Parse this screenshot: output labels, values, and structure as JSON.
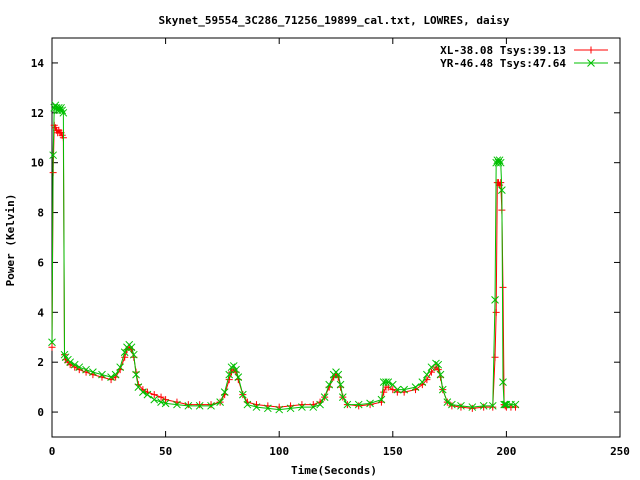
{
  "chart_data": {
    "type": "line",
    "title": "Skynet_59554_3C286_71256_19899_cal.txt, LOWRES, daisy",
    "xlabel": "Time(Seconds)",
    "ylabel": "Power (Kelvin)",
    "xlim": [
      0,
      250
    ],
    "ylim": [
      -1,
      15
    ],
    "xticks": [
      0,
      50,
      100,
      150,
      200,
      250
    ],
    "yticks": [
      0,
      2,
      4,
      6,
      8,
      10,
      12,
      14
    ],
    "grid": false,
    "legend_position": "top-right",
    "series": [
      {
        "name": "XL-38.08 Tsys:39.13",
        "color": "#ff0000",
        "marker": "plus",
        "x": [
          0,
          0.5,
          1,
          1.5,
          2,
          2.5,
          3,
          3.5,
          4,
          4.5,
          5,
          5.5,
          6,
          7,
          8,
          10,
          12,
          15,
          18,
          22,
          26,
          28,
          30,
          32,
          33,
          34,
          35,
          36,
          37,
          38,
          40,
          42,
          45,
          48,
          50,
          55,
          60,
          65,
          70,
          74,
          76,
          78,
          79,
          80,
          81,
          82,
          84,
          86,
          90,
          95,
          100,
          105,
          110,
          115,
          118,
          120,
          122,
          124,
          125,
          126,
          127,
          128,
          130,
          135,
          140,
          145,
          146,
          147,
          148,
          150,
          152,
          155,
          160,
          163,
          165,
          167,
          169,
          170,
          171,
          172,
          174,
          176,
          180,
          185,
          190,
          194,
          195,
          195.5,
          196,
          196.5,
          197,
          197.5,
          198,
          198.5,
          199,
          199.5,
          200,
          202,
          204
        ],
        "y": [
          2.6,
          9.6,
          11.5,
          11.4,
          11.3,
          11.2,
          11.3,
          11.2,
          11.2,
          11.1,
          11.0,
          2.3,
          2.1,
          2.0,
          1.9,
          1.8,
          1.7,
          1.6,
          1.5,
          1.4,
          1.3,
          1.4,
          1.7,
          2.2,
          2.5,
          2.6,
          2.5,
          2.2,
          1.6,
          1.1,
          0.9,
          0.8,
          0.7,
          0.6,
          0.5,
          0.4,
          0.3,
          0.3,
          0.3,
          0.4,
          0.7,
          1.3,
          1.6,
          1.7,
          1.6,
          1.3,
          0.7,
          0.4,
          0.3,
          0.25,
          0.2,
          0.25,
          0.3,
          0.3,
          0.4,
          0.6,
          1.0,
          1.4,
          1.5,
          1.4,
          1.0,
          0.6,
          0.3,
          0.25,
          0.3,
          0.4,
          0.8,
          1.0,
          1.0,
          0.9,
          0.8,
          0.8,
          0.9,
          1.1,
          1.3,
          1.6,
          1.8,
          1.7,
          1.4,
          0.9,
          0.4,
          0.25,
          0.2,
          0.15,
          0.2,
          0.2,
          2.2,
          4.0,
          9.2,
          9.2,
          9.1,
          9.2,
          8.1,
          5.0,
          0.3,
          0.25,
          0.2,
          0.2,
          0.2
        ]
      },
      {
        "name": "YR-46.48 Tsys:47.64",
        "color": "#00c000",
        "marker": "cross",
        "x": [
          0,
          0.5,
          1,
          1.5,
          2,
          2.5,
          3,
          3.5,
          4,
          4.5,
          5,
          5.5,
          6,
          7,
          8,
          10,
          12,
          15,
          18,
          22,
          26,
          28,
          30,
          32,
          33,
          34,
          35,
          36,
          37,
          38,
          40,
          42,
          45,
          48,
          50,
          55,
          60,
          65,
          70,
          74,
          76,
          78,
          79,
          80,
          81,
          82,
          84,
          86,
          90,
          95,
          100,
          105,
          110,
          115,
          118,
          120,
          122,
          124,
          125,
          126,
          127,
          128,
          130,
          135,
          140,
          145,
          146,
          147,
          148,
          150,
          152,
          155,
          160,
          163,
          165,
          167,
          169,
          170,
          171,
          172,
          174,
          176,
          180,
          185,
          190,
          194,
          195,
          195.5,
          196,
          196.5,
          197,
          197.5,
          198,
          198.5,
          199,
          199.5,
          200,
          202,
          204
        ],
        "y": [
          2.8,
          10.3,
          12.2,
          12.3,
          12.2,
          12.1,
          12.2,
          12.1,
          12.2,
          12.1,
          12.0,
          2.3,
          2.2,
          2.1,
          2.0,
          1.9,
          1.8,
          1.7,
          1.6,
          1.5,
          1.4,
          1.5,
          1.8,
          2.4,
          2.6,
          2.7,
          2.6,
          2.3,
          1.5,
          1.0,
          0.8,
          0.7,
          0.5,
          0.4,
          0.35,
          0.3,
          0.25,
          0.25,
          0.25,
          0.4,
          0.8,
          1.5,
          1.8,
          1.85,
          1.7,
          1.4,
          0.7,
          0.3,
          0.2,
          0.15,
          0.1,
          0.15,
          0.2,
          0.2,
          0.3,
          0.6,
          1.1,
          1.5,
          1.6,
          1.5,
          1.1,
          0.6,
          0.3,
          0.3,
          0.35,
          0.5,
          1.2,
          1.2,
          1.2,
          1.1,
          0.9,
          0.9,
          1.0,
          1.2,
          1.5,
          1.8,
          1.95,
          1.9,
          1.5,
          0.9,
          0.4,
          0.3,
          0.25,
          0.2,
          0.25,
          0.25,
          4.5,
          10.0,
          10.1,
          10.0,
          10.1,
          10.0,
          8.9,
          1.2,
          0.3,
          0.3,
          0.3,
          0.3,
          0.3
        ]
      }
    ]
  }
}
